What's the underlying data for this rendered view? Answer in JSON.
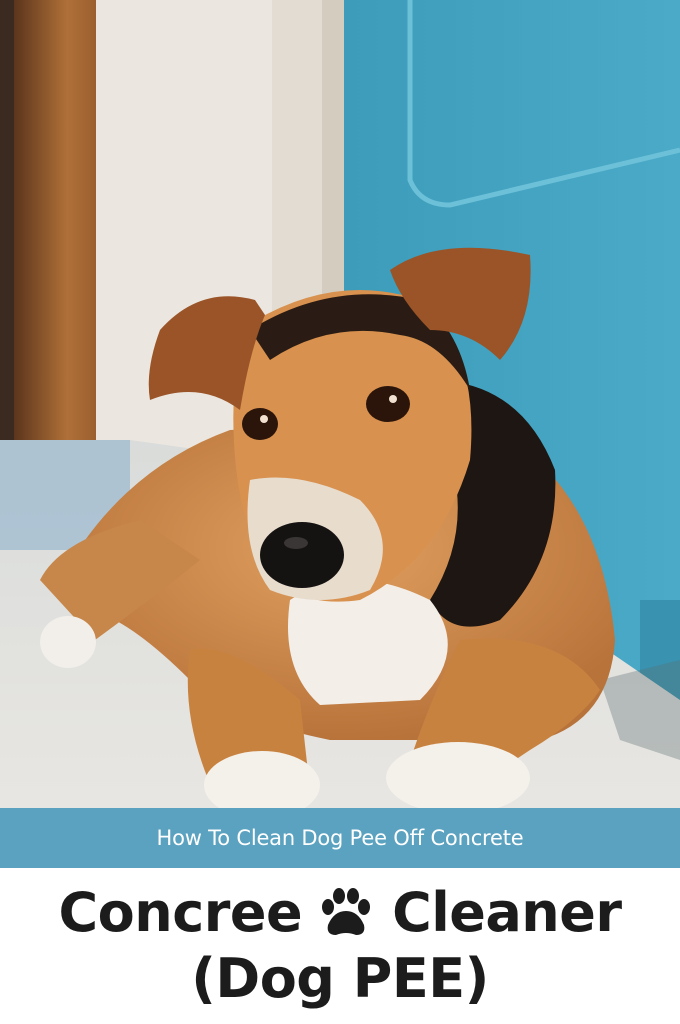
{
  "banner": {
    "text": "How To Clean Dog Pee Off Concrete"
  },
  "title": {
    "word_1": "Concree",
    "word_2": "Cleaner",
    "line_2": "(Dog PEE)"
  },
  "icons": {
    "title_icon": "paw-print-icon"
  },
  "colors": {
    "banner": "#5aa2bf",
    "wall": "#3f9fbc",
    "title_text": "#1c1c1c"
  }
}
